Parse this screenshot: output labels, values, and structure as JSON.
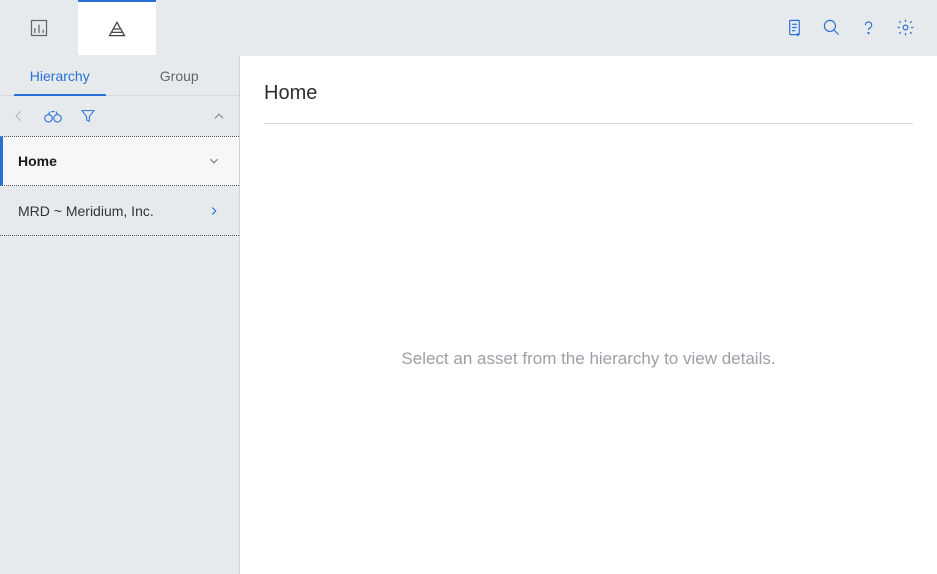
{
  "topTabs": [
    {
      "name": "dashboard"
    },
    {
      "name": "hierarchy",
      "active": true
    }
  ],
  "topIcons": {
    "clipboard": "clipboard-icon",
    "search": "search-icon",
    "help": "help-icon",
    "settings": "gear-icon"
  },
  "sidebar": {
    "tabs": {
      "hierarchy": "Hierarchy",
      "group": "Group"
    },
    "toolbar": {
      "back": "back",
      "binoculars": "binoculars",
      "filter": "filter",
      "collapse": "collapse"
    },
    "items": [
      {
        "label": "Home",
        "active": true,
        "expand": "down"
      },
      {
        "label": "MRD ~ Meridium, Inc.",
        "active": false,
        "expand": "right"
      }
    ]
  },
  "content": {
    "title": "Home",
    "placeholder": "Select an asset from the hierarchy to view details."
  }
}
